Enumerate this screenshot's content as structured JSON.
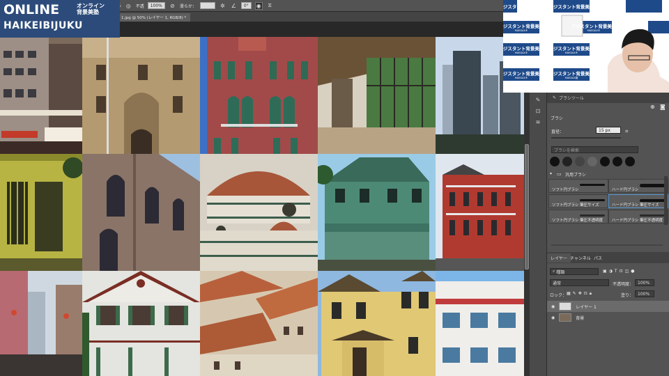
{
  "logo": {
    "line1": "ONLINE",
    "jp_line1": "オンライン",
    "jp_line2": "背景美塾",
    "line2": "HAIKEIBIJUKU"
  },
  "options_bar": {
    "zoom_value": "%",
    "opacity_label": "不透",
    "opacity_value": "100%",
    "smoothing_label": "滑らか：",
    "angle_value": "0°"
  },
  "doc_tab": {
    "title": "1.jpg @ 50% (レイヤー 1, RGB/8) *",
    "close": "×"
  },
  "backdrop_text": {
    "big": "アジスタント背景美塾",
    "small": "MAEDAX®",
    "alt_small": "MAEDAX展"
  },
  "panel": {
    "collapsed_label": "ブラシツール",
    "tab_brush": "ブラシ",
    "size_label": "直径：",
    "size_value": "15 px",
    "search_placeholder": "ブラシを検索",
    "group_label": "汎用ブラシ",
    "brushes": [
      {
        "name": "ソフト円ブラシ"
      },
      {
        "name": "ハード円ブラシ"
      },
      {
        "name": "ソフト円ブラシ 筆圧サイズ"
      },
      {
        "name": "ハード円ブラシ 筆圧サイズ"
      },
      {
        "name": "ソフト円ブラシ 筆圧不透明度"
      },
      {
        "name": "ハード円ブラシ 筆圧不透明度"
      }
    ],
    "layers_tabs": [
      "レイヤー",
      "チャンネル",
      "パス"
    ],
    "kind_label": "種類",
    "blend_mode": "通常",
    "opacity_label": "不透明度：",
    "opacity_value": "100%",
    "lock_label": "ロック：",
    "fill_label": "塗り：",
    "fill_value": "100%",
    "layers": [
      {
        "name": "レイヤー 1",
        "selected": true
      },
      {
        "name": "背景",
        "selected": false
      }
    ]
  },
  "colors": {
    "logo_bg": "#2c4b7a",
    "ps_panel": "#535353",
    "ps_dark": "#3d3d3d",
    "selection_blue": "#5a9bd6"
  }
}
